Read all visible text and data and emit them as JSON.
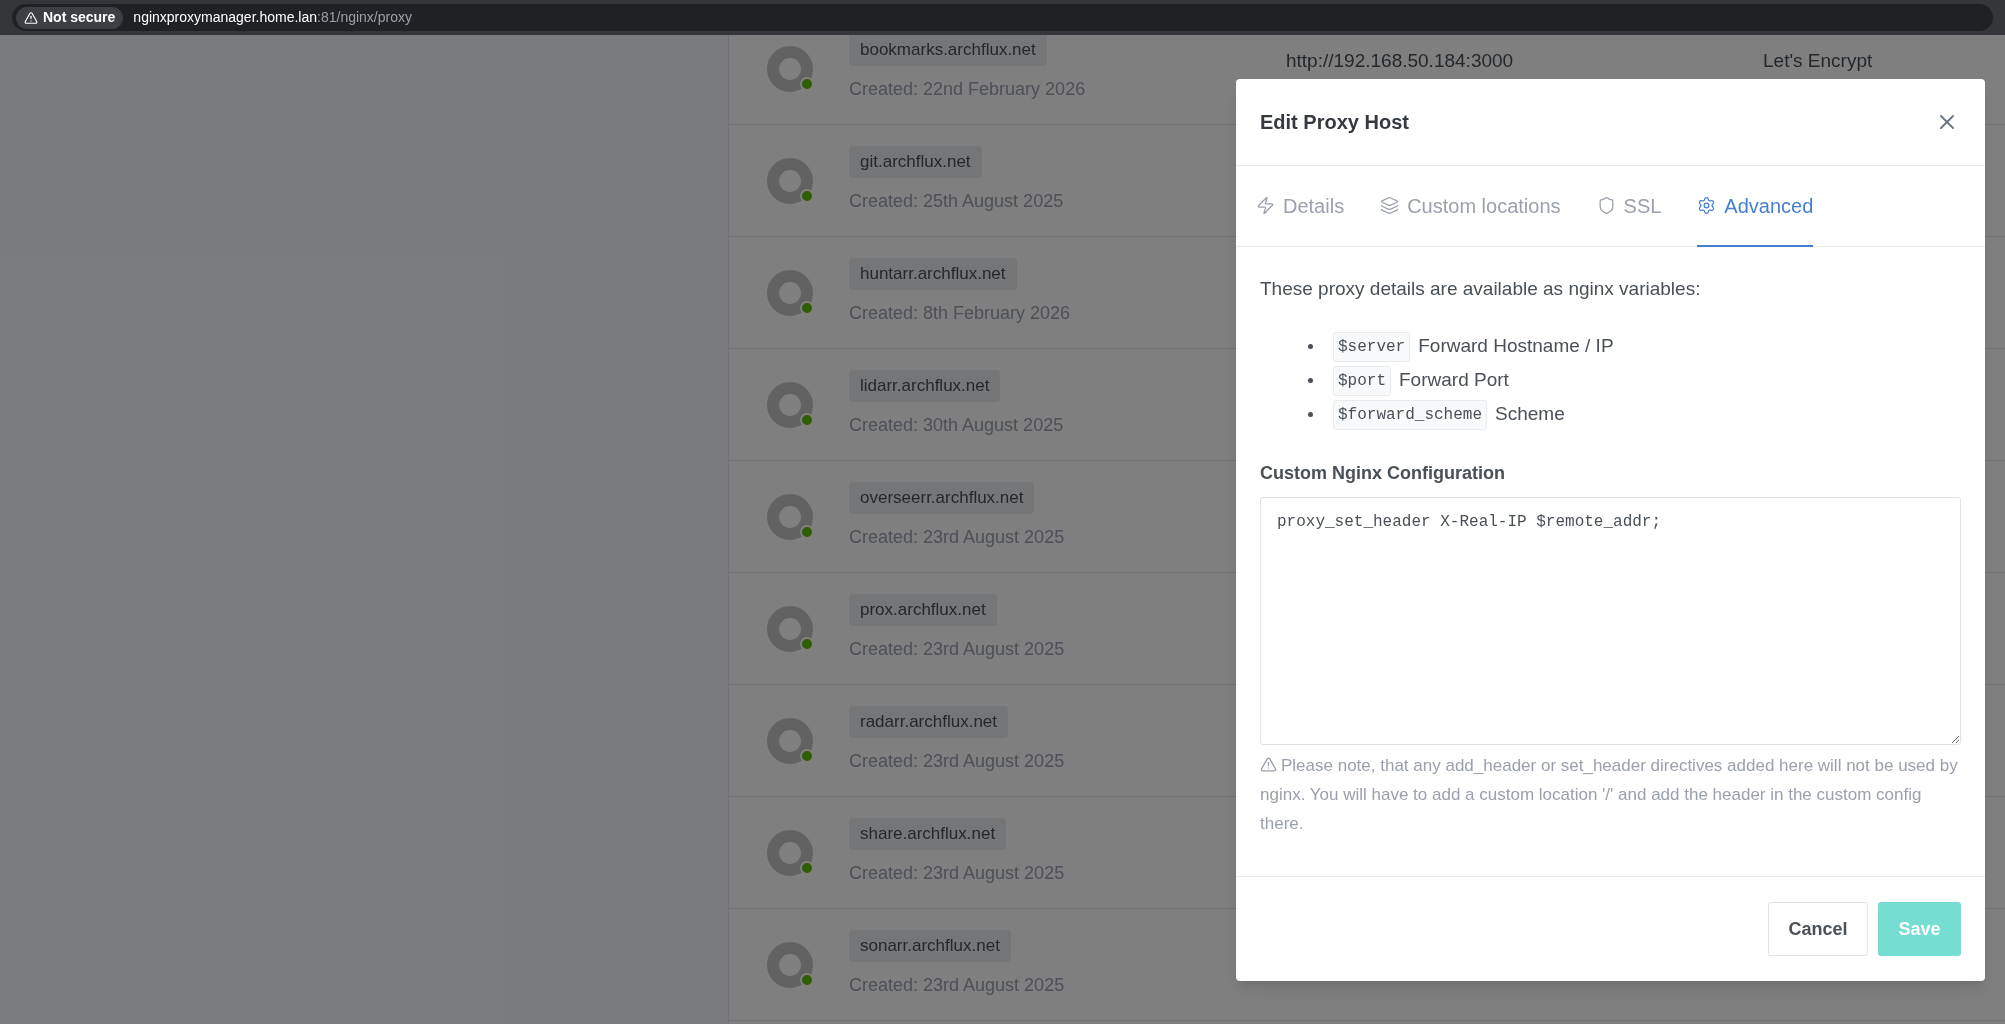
{
  "browser": {
    "security_label": "Not secure",
    "url_host": "nginxproxymanager.home.lan",
    "url_path": ":81/nginx/proxy"
  },
  "hosts": [
    {
      "domain": "bookmarks.archflux.net",
      "created": "Created: 22nd February 2026",
      "online": true,
      "forward": "http://192.168.50.184:3000",
      "ssl": "Let's Encrypt"
    },
    {
      "domain": "git.archflux.net",
      "created": "Created: 25th August 2025",
      "online": true
    },
    {
      "domain": "huntarr.archflux.net",
      "created": "Created: 8th February 2026",
      "online": true
    },
    {
      "domain": "lidarr.archflux.net",
      "created": "Created: 30th August 2025",
      "online": true
    },
    {
      "domain": "overseerr.archflux.net",
      "created": "Created: 23rd August 2025",
      "online": true
    },
    {
      "domain": "prox.archflux.net",
      "created": "Created: 23rd August 2025",
      "online": true
    },
    {
      "domain": "radarr.archflux.net",
      "created": "Created: 23rd August 2025",
      "online": true
    },
    {
      "domain": "share.archflux.net",
      "created": "Created: 23rd August 2025",
      "online": true
    },
    {
      "domain": "sonarr.archflux.net",
      "created": "Created: 23rd August 2025",
      "online": true
    }
  ],
  "modal": {
    "title": "Edit Proxy Host",
    "tabs": [
      {
        "label": "Details",
        "selected": false
      },
      {
        "label": "Custom locations",
        "selected": false
      },
      {
        "label": "SSL",
        "selected": false
      },
      {
        "label": "Advanced",
        "selected": true
      }
    ],
    "intro": "These proxy details are available as nginx variables:",
    "variables": [
      {
        "code": "$server",
        "text": "Forward Hostname / IP"
      },
      {
        "code": "$port",
        "text": "Forward Port"
      },
      {
        "code": "$forward_scheme",
        "text": "Scheme"
      }
    ],
    "config_label": "Custom Nginx Configuration",
    "config_value": "proxy_set_header X-Real-IP $remote_addr;",
    "note": "Please note, that any add_header or set_header directives added here will not be used by nginx. You will have to add a custom location '/' and add the header in the custom config there.",
    "cancel": {
      "label": "Cancel",
      "disabled": false
    },
    "save": {
      "label": "Save",
      "disabled": true
    }
  }
}
